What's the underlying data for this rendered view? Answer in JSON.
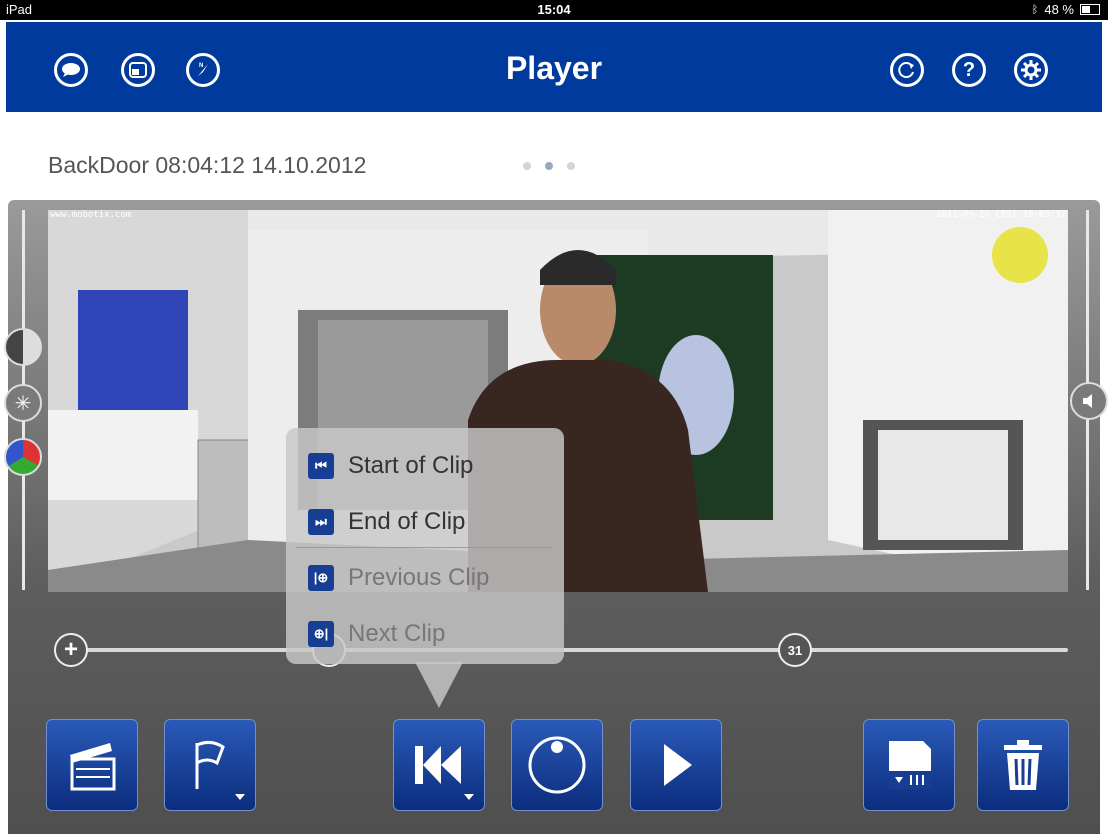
{
  "status_bar": {
    "device": "iPad",
    "time": "15:04",
    "battery": "48 %"
  },
  "nav": {
    "title": "Player",
    "left_icons": [
      "chat-bubble-icon",
      "window-icon",
      "compass-icon"
    ],
    "right_icons": [
      "refresh-icon",
      "help-icon",
      "settings-gear-icon"
    ],
    "help_glyph": "?"
  },
  "camera": {
    "label": "BackDoor 08:04:12 14.10.2012"
  },
  "pager": {
    "pages": 3,
    "active": 2
  },
  "video": {
    "overlay_left": "www.mobotix.com",
    "overlay_right": "2011-09-16 CEST 16:03:37"
  },
  "popover": {
    "items": [
      {
        "label": "Start of Clip",
        "icon": "skip-to-start-icon",
        "glyph": "⏮",
        "enabled": true
      },
      {
        "label": "End of Clip",
        "icon": "skip-to-end-icon",
        "glyph": "⏭",
        "enabled": true
      },
      {
        "label": "Previous Clip",
        "icon": "previous-clip-icon",
        "glyph": "|⊕",
        "enabled": false
      },
      {
        "label": "Next Clip",
        "icon": "next-clip-icon",
        "glyph": "⊕|",
        "enabled": false
      }
    ]
  },
  "slider": {
    "plus": "+",
    "calendar_day": "31"
  },
  "bottom_toolbar": {
    "buttons": [
      "clapperboard-icon",
      "flag-icon",
      "skip-to-start-icon",
      "record-dial-icon",
      "play-icon",
      "sd-card-icon",
      "trash-icon"
    ]
  },
  "colors": {
    "nav_blue": "#003a9c",
    "button_blue": "#173e93",
    "marker_yellow": "#e6e02a"
  }
}
